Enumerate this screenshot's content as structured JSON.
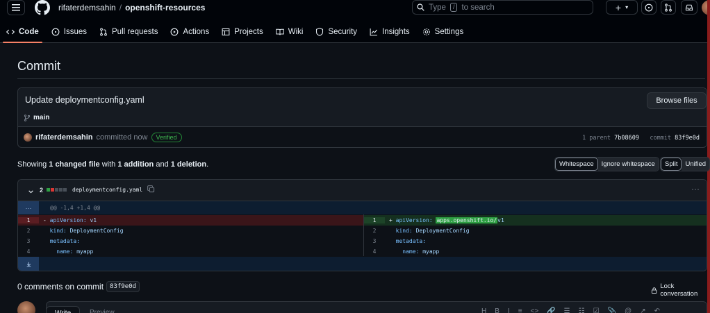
{
  "header": {
    "owner": "rifaterdemsahin",
    "separator": "/",
    "repo": "openshift-resources",
    "search_prefix": "Type",
    "search_key": "/",
    "search_suffix": "to search",
    "plus_label": "+"
  },
  "tabs": [
    {
      "label": "Code",
      "icon": "code-icon"
    },
    {
      "label": "Issues",
      "icon": "issue-icon"
    },
    {
      "label": "Pull requests",
      "icon": "pull-request-icon"
    },
    {
      "label": "Actions",
      "icon": "play-icon"
    },
    {
      "label": "Projects",
      "icon": "table-icon"
    },
    {
      "label": "Wiki",
      "icon": "book-icon"
    },
    {
      "label": "Security",
      "icon": "shield-icon"
    },
    {
      "label": "Insights",
      "icon": "graph-icon"
    },
    {
      "label": "Settings",
      "icon": "gear-icon"
    }
  ],
  "page_title": "Commit",
  "commit": {
    "message": "Update deploymentconfig.yaml",
    "browse_label": "Browse files",
    "branch": "main",
    "author": "rifaterdemsahin",
    "action": "committed now",
    "verified": "Verified",
    "parent_label": "1 parent",
    "parent_sha": "7b08609",
    "commit_label": "commit",
    "commit_sha": "83f9e0d"
  },
  "summary": {
    "showing": "Showing",
    "files": "1 changed file",
    "with": "with",
    "additions": "1 addition",
    "and": "and",
    "deletions": "1 deletion",
    "period": "."
  },
  "whitespace_toggle": {
    "on": "Whitespace",
    "off": "Ignore whitespace"
  },
  "view_toggle": {
    "on": "Split",
    "off": "Unified"
  },
  "diff": {
    "count": "2",
    "filename": "deploymentconfig.yaml",
    "more": "···",
    "hunk_gutter": "···",
    "hunk": "@@ -1,4 +1,4 @@",
    "left": [
      {
        "n": "1",
        "mark": "-",
        "key": "apiVersion:",
        "val": "v1"
      },
      {
        "n": "2",
        "mark": "",
        "key": "kind:",
        "val": "DeploymentConfig"
      },
      {
        "n": "3",
        "mark": "",
        "key": "metadata:",
        "val": ""
      },
      {
        "n": "4",
        "mark": "",
        "key": "  name:",
        "val": "myapp"
      }
    ],
    "right": [
      {
        "n": "1",
        "mark": "+",
        "key": "apiVersion:",
        "val_hl": "apps.openshift.io/",
        "val": "v1"
      },
      {
        "n": "2",
        "mark": "",
        "key": "kind:",
        "val": "DeploymentConfig"
      },
      {
        "n": "3",
        "mark": "",
        "key": "metadata:",
        "val": ""
      },
      {
        "n": "4",
        "mark": "",
        "key": "  name:",
        "val": "myapp"
      }
    ]
  },
  "comments": {
    "label": "0 comments on commit",
    "sha": "83f9e0d",
    "lock": "Lock conversation"
  },
  "composer": {
    "write": "Write",
    "preview": "Preview",
    "tools": [
      "H",
      "B",
      "I",
      "≡",
      "<>",
      "🔗",
      "☰",
      "☷",
      "☑",
      "📎",
      "@",
      "↗",
      "↶"
    ]
  },
  "colors": {
    "accent_tab": "#f78166",
    "added": "#2ea043",
    "deleted": "#5a1d22",
    "verified": "#3fb950"
  }
}
